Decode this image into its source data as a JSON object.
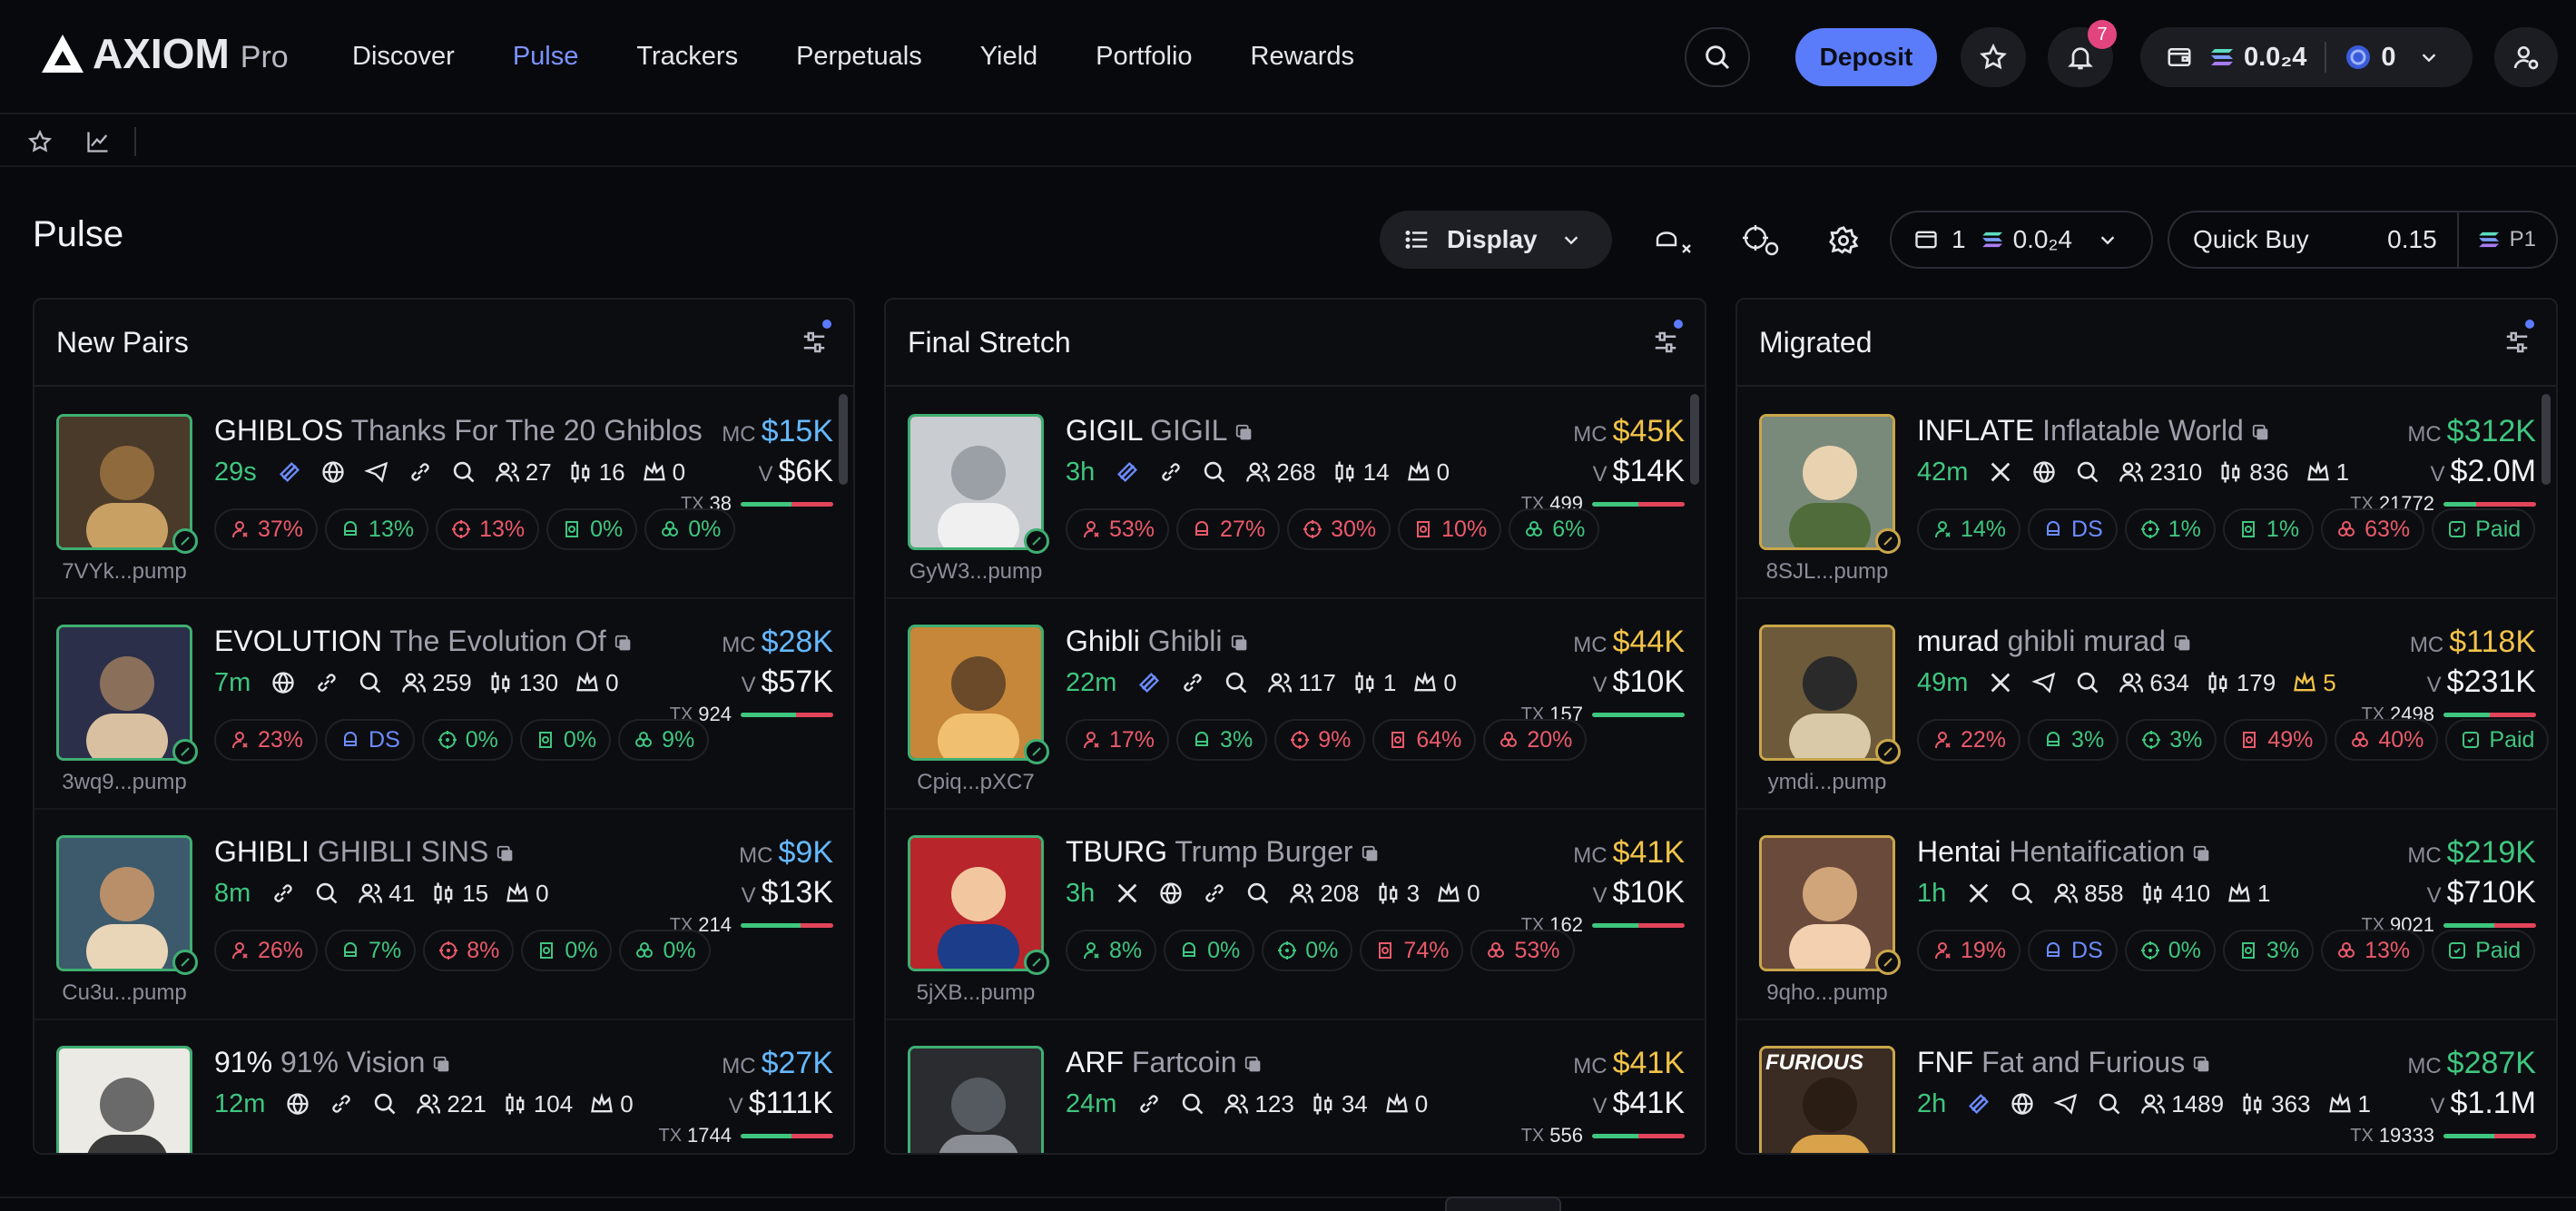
{
  "brand": {
    "name": "AXIOM",
    "tier": "Pro"
  },
  "nav": [
    "Discover",
    "Pulse",
    "Trackers",
    "Perpetuals",
    "Yield",
    "Portfolio",
    "Rewards"
  ],
  "nav_active": "Pulse",
  "header": {
    "deposit": "Deposit",
    "notifications_count": "7",
    "sol_balance": "0.0₂4",
    "points": "0"
  },
  "page": {
    "title": "Pulse",
    "display": "Display",
    "wallet_count": "1",
    "wallet_balance": "0.0₂4",
    "quick_buy_label": "Quick Buy",
    "quick_buy_amount": "0.15",
    "preset": "P1"
  },
  "columns": [
    {
      "title": "New Pairs",
      "cards": [
        {
          "ticker": "GHIBLOS",
          "name": "Thanks For The 20 Ghiblos",
          "addr": "7VYk...pump",
          "age": "29s",
          "socials": [
            "pump",
            "web",
            "telegram",
            "link",
            "search"
          ],
          "holders": "27",
          "swaps": "16",
          "kols": "0",
          "mc": "$15K",
          "mc_color": "blue",
          "v": "$6K",
          "tx": "38",
          "buy_ratio": 0.55,
          "pills": [
            [
              "r",
              "37%"
            ],
            [
              "g",
              "13%"
            ],
            [
              "r",
              "13%"
            ],
            [
              "g",
              "0%"
            ],
            [
              "g",
              "0%"
            ]
          ],
          "copy": false
        },
        {
          "ticker": "EVOLUTION",
          "name": "The Evolution Of",
          "addr": "3wq9...pump",
          "age": "7m",
          "socials": [
            "web",
            "link",
            "search"
          ],
          "holders": "259",
          "swaps": "130",
          "kols": "0",
          "mc": "$28K",
          "mc_color": "blue",
          "v": "$57K",
          "tx": "924",
          "buy_ratio": 0.6,
          "pills": [
            [
              "r",
              "23%"
            ],
            [
              "b",
              "DS"
            ],
            [
              "g",
              "0%"
            ],
            [
              "g",
              "0%"
            ],
            [
              "g",
              "9%"
            ]
          ],
          "copy": true
        },
        {
          "ticker": "GHIBLI",
          "name": "GHIBLI SINS",
          "addr": "Cu3u...pump",
          "age": "8m",
          "socials": [
            "link",
            "search"
          ],
          "holders": "41",
          "swaps": "15",
          "kols": "0",
          "mc": "$9K",
          "mc_color": "blue",
          "v": "$13K",
          "tx": "214",
          "buy_ratio": 0.65,
          "pills": [
            [
              "r",
              "26%"
            ],
            [
              "g",
              "7%"
            ],
            [
              "r",
              "8%"
            ],
            [
              "g",
              "0%"
            ],
            [
              "g",
              "0%"
            ]
          ],
          "copy": true
        },
        {
          "ticker": "91%",
          "name": "91% Vision",
          "addr": "",
          "age": "12m",
          "socials": [
            "web",
            "link",
            "search"
          ],
          "holders": "221",
          "swaps": "104",
          "kols": "0",
          "mc": "$27K",
          "mc_color": "blue",
          "v": "$111K",
          "tx": "1744",
          "buy_ratio": 0.55,
          "pills": [],
          "copy": true
        }
      ]
    },
    {
      "title": "Final Stretch",
      "cards": [
        {
          "ticker": "GIGIL",
          "name": "GIGIL",
          "addr": "GyW3...pump",
          "age": "3h",
          "socials": [
            "pump",
            "link",
            "search"
          ],
          "holders": "268",
          "swaps": "14",
          "kols": "0",
          "mc": "$45K",
          "mc_color": "yellow",
          "v": "$14K",
          "tx": "499",
          "buy_ratio": 0.5,
          "pills": [
            [
              "r",
              "53%"
            ],
            [
              "r",
              "27%"
            ],
            [
              "r",
              "30%"
            ],
            [
              "r",
              "10%"
            ],
            [
              "g",
              "6%"
            ]
          ],
          "copy": true
        },
        {
          "ticker": "Ghibli",
          "name": "Ghibli",
          "addr": "Cpiq...pXC7",
          "age": "22m",
          "socials": [
            "pump",
            "link",
            "search"
          ],
          "holders": "117",
          "swaps": "1",
          "kols": "0",
          "mc": "$44K",
          "mc_color": "yellow",
          "v": "$10K",
          "tx": "157",
          "buy_ratio": 1.0,
          "pills": [
            [
              "r",
              "17%"
            ],
            [
              "g",
              "3%"
            ],
            [
              "r",
              "9%"
            ],
            [
              "r",
              "64%"
            ],
            [
              "r",
              "20%"
            ]
          ],
          "copy": true
        },
        {
          "ticker": "TBURG",
          "name": "Trump Burger",
          "addr": "5jXB...pump",
          "age": "3h",
          "socials": [
            "x",
            "web",
            "link",
            "search"
          ],
          "holders": "208",
          "swaps": "3",
          "kols": "0",
          "mc": "$41K",
          "mc_color": "yellow",
          "v": "$10K",
          "tx": "162",
          "buy_ratio": 0.5,
          "pills": [
            [
              "g",
              "8%"
            ],
            [
              "g",
              "0%"
            ],
            [
              "g",
              "0%"
            ],
            [
              "r",
              "74%"
            ],
            [
              "r",
              "53%"
            ]
          ],
          "copy": true
        },
        {
          "ticker": "ARF",
          "name": "Fartcoin",
          "addr": "",
          "age": "24m",
          "socials": [
            "link",
            "search"
          ],
          "holders": "123",
          "swaps": "34",
          "kols": "0",
          "mc": "$41K",
          "mc_color": "yellow",
          "v": "$41K",
          "tx": "556",
          "buy_ratio": 0.5,
          "pills": [],
          "copy": true
        }
      ]
    },
    {
      "title": "Migrated",
      "cards": [
        {
          "ticker": "INFLATE",
          "name": "Inflatable World",
          "addr": "8SJL...pump",
          "age": "42m",
          "socials": [
            "x",
            "web",
            "search"
          ],
          "holders": "2310",
          "swaps": "836",
          "kols": "1",
          "mc": "$312K",
          "mc_color": "green",
          "v": "$2.0M",
          "tx": "21772",
          "buy_ratio": 0.35,
          "pills": [
            [
              "g",
              "14%"
            ],
            [
              "b",
              "DS"
            ],
            [
              "g",
              "1%"
            ],
            [
              "g",
              "1%"
            ],
            [
              "r",
              "63%"
            ],
            [
              "g",
              "Paid"
            ]
          ],
          "copy": true,
          "gold": true
        },
        {
          "ticker": "murad",
          "name": "ghibli murad",
          "addr": "ymdi...pump",
          "age": "49m",
          "socials": [
            "x",
            "telegram",
            "search"
          ],
          "holders": "634",
          "swaps": "179",
          "kols": "5",
          "kols_gold": true,
          "mc": "$118K",
          "mc_color": "yellow",
          "v": "$231K",
          "tx": "2498",
          "buy_ratio": 0.5,
          "pills": [
            [
              "r",
              "22%"
            ],
            [
              "g",
              "3%"
            ],
            [
              "g",
              "3%"
            ],
            [
              "r",
              "49%"
            ],
            [
              "r",
              "40%"
            ],
            [
              "g",
              "Paid"
            ]
          ],
          "copy": true,
          "gold": true
        },
        {
          "ticker": "Hentai",
          "name": "Hentaification",
          "addr": "9qho...pump",
          "age": "1h",
          "socials": [
            "x",
            "search"
          ],
          "holders": "858",
          "swaps": "410",
          "kols": "1",
          "mc": "$219K",
          "mc_color": "green",
          "v": "$710K",
          "tx": "9021",
          "buy_ratio": 0.55,
          "pills": [
            [
              "r",
              "19%"
            ],
            [
              "b",
              "DS"
            ],
            [
              "g",
              "0%"
            ],
            [
              "g",
              "3%"
            ],
            [
              "r",
              "13%"
            ],
            [
              "g",
              "Paid"
            ]
          ],
          "copy": true,
          "gold": true
        },
        {
          "ticker": "FNF",
          "name": "Fat and Furious",
          "addr": "",
          "age": "2h",
          "socials": [
            "pump",
            "web",
            "telegram",
            "search"
          ],
          "holders": "1489",
          "swaps": "363",
          "kols": "1",
          "mc": "$287K",
          "mc_color": "green",
          "v": "$1.1M",
          "tx": "19333",
          "buy_ratio": 0.55,
          "pills": [],
          "copy": true,
          "gold": true
        }
      ]
    }
  ],
  "avatar_logo_text": "FURIOUS",
  "colors": {
    "accent": "#5b7cfa",
    "green": "#3fc67f",
    "red": "#ea5a6a",
    "blue": "#65b9ff",
    "yellow": "#f1c348",
    "bg": "#08090c"
  }
}
